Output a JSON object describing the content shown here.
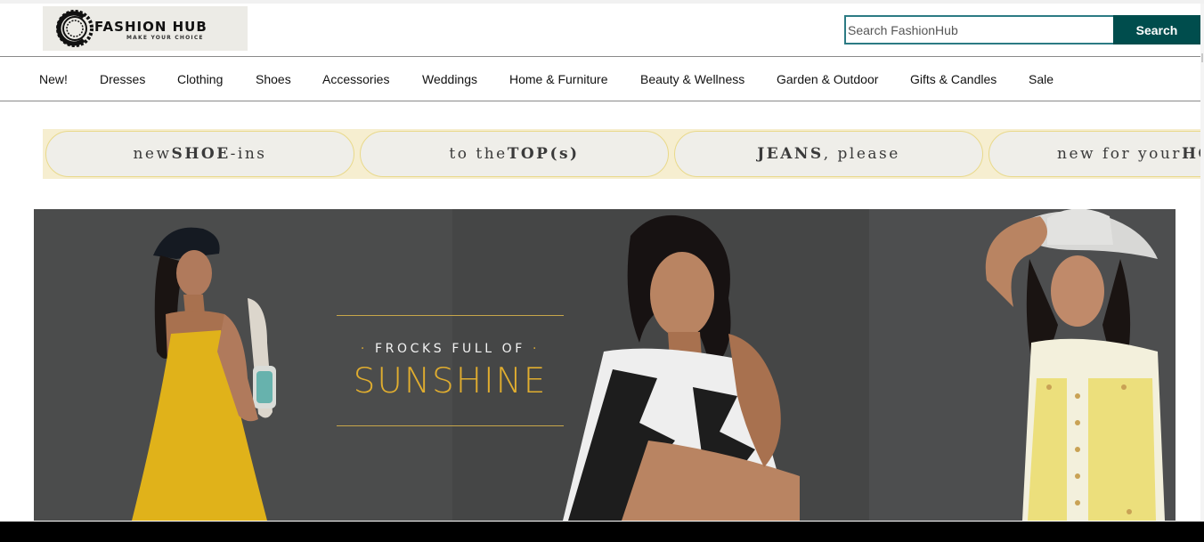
{
  "brand": {
    "name": "FASHION HUB",
    "tagline": "MAKE YOUR CHOICE"
  },
  "search": {
    "placeholder": "Search FashionHub",
    "button_label": "Search"
  },
  "nav": {
    "items": [
      "New!",
      "Dresses",
      "Clothing",
      "Shoes",
      "Accessories",
      "Weddings",
      "Home & Furniture",
      "Beauty & Wellness",
      "Garden & Outdoor",
      "Gifts & Candles",
      "Sale"
    ]
  },
  "promos": [
    {
      "pre": "new ",
      "bold": "SHOE",
      "post": "-ins"
    },
    {
      "pre": "to the ",
      "bold": "TOP(s)",
      "post": ""
    },
    {
      "pre": "",
      "bold": "JEANS",
      "post": ", please"
    },
    {
      "pre": "new for your ",
      "bold": "HO",
      "post": ""
    }
  ],
  "hero": {
    "kicker": "FROCKS FULL OF",
    "title": "SUNSHINE"
  },
  "colors": {
    "accent": "#004d4d",
    "search_border": "#2c7b84",
    "gold": "#e0ad2f",
    "promo_strip": "#f6eed0"
  }
}
